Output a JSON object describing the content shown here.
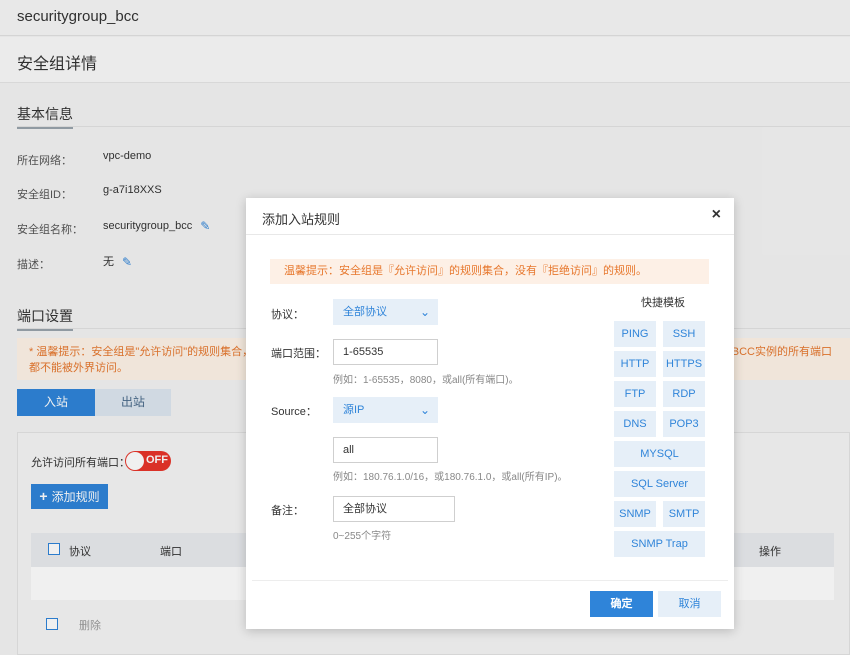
{
  "header": {
    "title": "securitygroup_bcc"
  },
  "page": {
    "title": "安全组详情"
  },
  "basic_info": {
    "section_title": "基本信息",
    "fields": [
      {
        "label": "所在网络：",
        "value": "vpc-demo"
      },
      {
        "label": "安全组ID：",
        "value": "g-a7i18XXS"
      },
      {
        "label": "安全组名称：",
        "value": "securitygroup_bcc"
      },
      {
        "label": "描述：",
        "value": "无"
      }
    ]
  },
  "port_settings": {
    "section_title": "端口设置",
    "tip_line1": "* 温馨提示：安全组是\"允许访问\"的规则集合，鞍",
    "tip_line1_tail": "此BCC实例的所有端口",
    "tip_line2": "都不能被外界访问。",
    "tabs": [
      "入站",
      "出站"
    ],
    "allow_all_label": "允许访问所有端口：",
    "toggle_label": "OFF",
    "add_rule_label": "添加规则",
    "table_headers": [
      "协议",
      "端口",
      "操作"
    ],
    "delete_label": "删除"
  },
  "modal": {
    "title": "添加入站规则",
    "close_label": "×",
    "tip": "温馨提示：安全组是『允许访问』的规则集合，没有『拒绝访问』的规则。",
    "protocol_label": "协议：",
    "protocol_value": "全部协议",
    "port_range_label": "端口范围：",
    "port_range_value": "1-65535",
    "port_range_hint": "例如：1-65535，8080，或all(所有端口)。",
    "source_label": "Source：",
    "source_value": "源IP",
    "source_ip_value": "all",
    "source_ip_hint": "例如：180.76.1.0/16，或180.76.1.0，或all(所有IP)。",
    "remark_label": "备注：",
    "remark_value": "全部协议",
    "remark_hint": "0~255个字符",
    "templates_title": "快捷模板",
    "templates": [
      "PING",
      "SSH",
      "HTTP",
      "HTTPS",
      "FTP",
      "RDP",
      "DNS",
      "POP3",
      "MYSQL",
      "SQL Server",
      "SNMP",
      "SMTP",
      "SNMP Trap"
    ],
    "ok_label": "确定",
    "cancel_label": "取消"
  },
  "icons": {
    "edit": "pencil-icon",
    "chevron": "chevron-down-icon",
    "plus": "plus-icon"
  },
  "colors": {
    "primary": "#2f84d9",
    "toggle_off": "#e8352a",
    "tip_text": "#e7782e",
    "tip_bg": "#fdf0e6"
  }
}
